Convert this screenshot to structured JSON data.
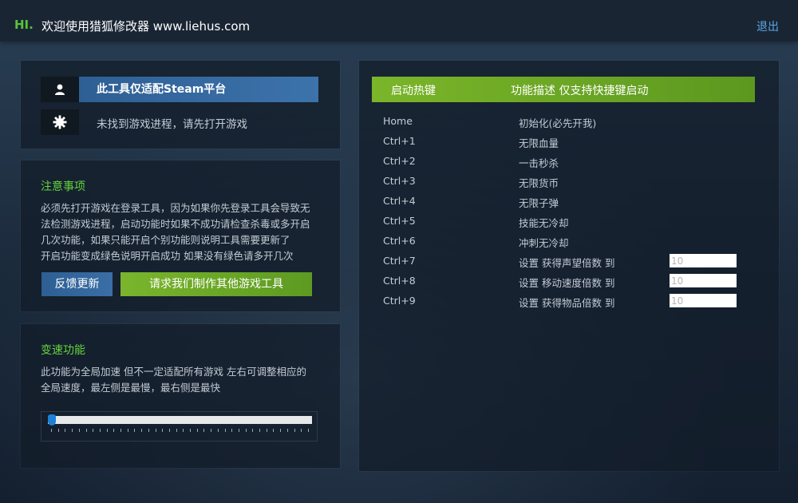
{
  "titlebar": {
    "hi": "HI.",
    "welcome": "欢迎使用猎狐修改器 www.liehus.com",
    "logout": "退出"
  },
  "status": {
    "platform_notice": "此工具仅适配Steam平台",
    "process_status": "未找到游戏进程，请先打开游戏",
    "user_icon": "user-icon",
    "gear_icon": "gear-icon"
  },
  "notice": {
    "title": "注意事项",
    "lines": [
      "必须先打开游戏在登录工具，因为如果你先登录工具会导致无",
      "法检测游戏进程，启动功能时如果不成功请检查杀毒或多开启",
      "几次功能，如果只能开启个别功能则说明工具需要更新了",
      "开启功能变成绿色说明开启成功 如果没有绿色请多开几次"
    ],
    "feedback_button": "反馈更新",
    "request_button": "请求我们制作其他游戏工具"
  },
  "speed": {
    "title": "变速功能",
    "lines": [
      "此功能为全局加速 但不一定适配所有游戏 左右可调整相应的",
      "全局速度，最左侧是最慢，最右侧是最快"
    ],
    "slider_value_fraction": 0.0
  },
  "hotkeys": {
    "header_key": "启动热键",
    "header_desc": "功能描述 仅支持快捷键启动",
    "rows": [
      {
        "key": "Home",
        "desc": "初始化(必先开我)"
      },
      {
        "key": "Ctrl+1",
        "desc": "无限血量"
      },
      {
        "key": "Ctrl+2",
        "desc": "一击秒杀"
      },
      {
        "key": "Ctrl+3",
        "desc": "无限货币"
      },
      {
        "key": "Ctrl+4",
        "desc": "无限子弹"
      },
      {
        "key": "Ctrl+5",
        "desc": "技能无冷却"
      },
      {
        "key": "Ctrl+6",
        "desc": "冲刺无冷却"
      },
      {
        "key": "Ctrl+7",
        "desc": "设置 获得声望倍数 到",
        "input_placeholder": "10"
      },
      {
        "key": "Ctrl+8",
        "desc": "设置 移动速度倍数 到",
        "input_placeholder": "10"
      },
      {
        "key": "Ctrl+9",
        "desc": "设置 获得物品倍数 到",
        "input_placeholder": "10"
      }
    ]
  },
  "colors": {
    "accent_green": "#63d33c",
    "accent_blue": "#3c73ab",
    "link_blue": "#5aa9e6"
  }
}
